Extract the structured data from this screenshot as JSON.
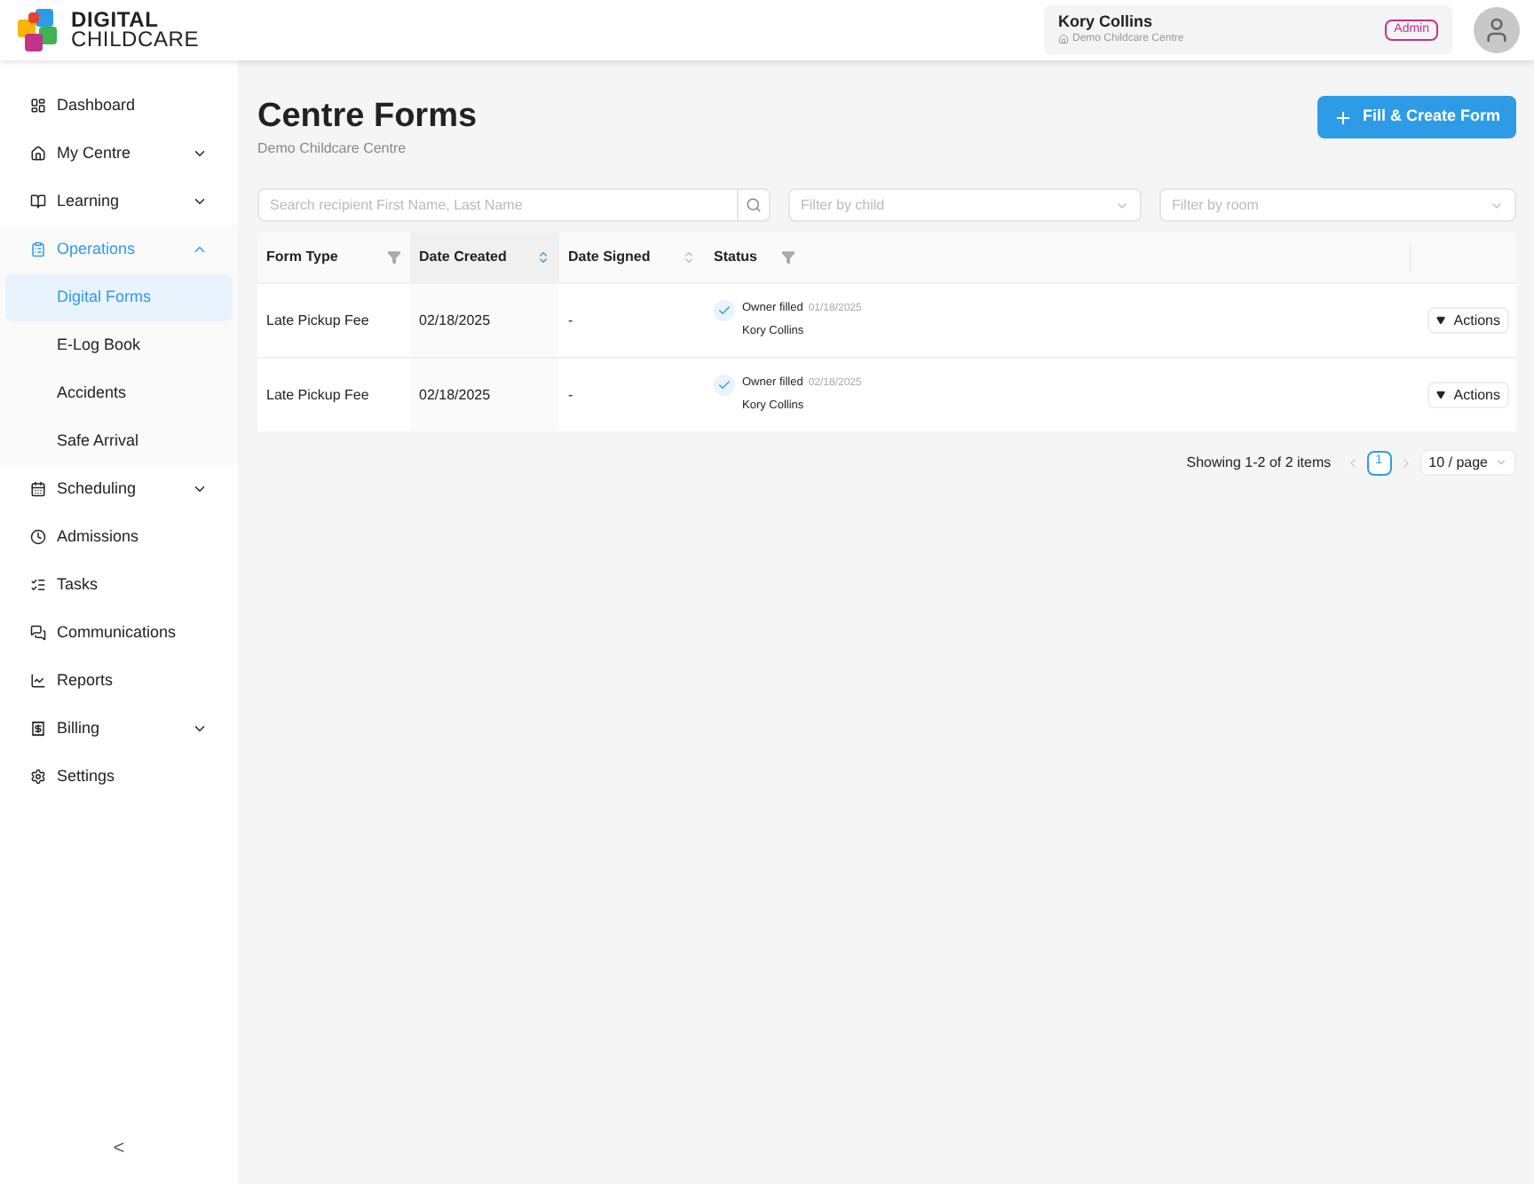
{
  "logo": {
    "line1": "DIGITAL",
    "line2": "CHILDCARE"
  },
  "user": {
    "name": "Kory Collins",
    "centre": "Demo Childcare Centre",
    "role": "Admin"
  },
  "sidebar": {
    "items": [
      {
        "label": "Dashboard",
        "selected": false
      },
      {
        "label": "My Centre",
        "selected": false,
        "expanded": false
      },
      {
        "label": "Learning",
        "selected": false,
        "expanded": false
      },
      {
        "label": "Operations",
        "selected": true,
        "expanded": true,
        "children": [
          {
            "label": "Digital Forms",
            "selected": true
          },
          {
            "label": "E-Log Book",
            "selected": false
          },
          {
            "label": "Accidents",
            "selected": false
          },
          {
            "label": "Safe Arrival",
            "selected": false
          }
        ]
      },
      {
        "label": "Scheduling",
        "selected": false,
        "expanded": false
      },
      {
        "label": "Admissions",
        "selected": false
      },
      {
        "label": "Tasks",
        "selected": false
      },
      {
        "label": "Communications",
        "selected": false
      },
      {
        "label": "Reports",
        "selected": false
      },
      {
        "label": "Billing",
        "selected": false,
        "expanded": false
      },
      {
        "label": "Settings",
        "selected": false
      }
    ],
    "collapse": "<"
  },
  "page": {
    "title": "Centre Forms",
    "subtitle": "Demo Childcare Centre",
    "create_button": "Fill & Create Form"
  },
  "filters": {
    "search": {
      "placeholder": "Search recipient First Name, Last Name"
    },
    "child": {
      "placeholder": "Filter by child"
    },
    "room": {
      "placeholder": "Filter by room"
    }
  },
  "table": {
    "columns": [
      {
        "label": "Form Type"
      },
      {
        "label": "Date Created",
        "sorted": true
      },
      {
        "label": "Date Signed",
        "sorted": false
      },
      {
        "label": "Status"
      }
    ],
    "rows": [
      {
        "form_type": "Late Pickup Fee",
        "date_created": "02/18/2025",
        "date_signed": "-",
        "status": "Owner filled",
        "status_date": "01/18/2025",
        "status_by": "Kory Collins",
        "action": "Actions"
      },
      {
        "form_type": "Late Pickup Fee",
        "date_created": "02/18/2025",
        "date_signed": "-",
        "status": "Owner filled",
        "status_date": "02/18/2025",
        "status_by": "Kory Collins",
        "action": "Actions"
      }
    ]
  },
  "pagination": {
    "summary": "Showing 1-2 of 2 items",
    "pages": [
      {
        "label": "1",
        "selected": true
      }
    ],
    "page_size": "10 / page"
  }
}
